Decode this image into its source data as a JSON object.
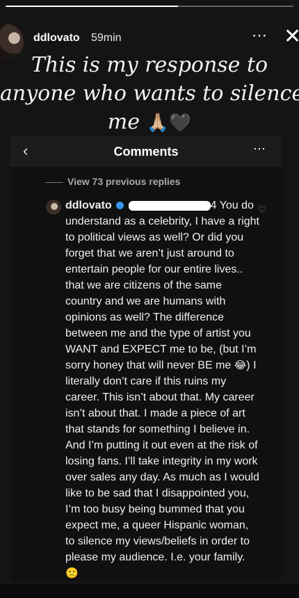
{
  "story": {
    "username": "ddlovato",
    "time_ago": "59min",
    "more_icon": "⋯",
    "close_icon": "✕",
    "caption_line1": "This is my response to",
    "caption_line2": "anyone who wants to silence",
    "caption_line3": "me",
    "caption_emoji": "🙏🏼🖤"
  },
  "comments_panel": {
    "back_icon": "‹",
    "title": "Comments",
    "more_icon": "⋯",
    "view_previous": "View 73 previous replies",
    "comment": {
      "username": "ddlovato",
      "mention_suffix": "4",
      "text_part1": "You do understand as a celebrity, I have a right to political views as well? Or did you forget that we aren’t just around to entertain people for our entire  lives.. that we are citizens of the same country and we are humans with opinions as well? The difference between me and the type of artist you WANT and EXPECT me to be, (but I’m sorry honey that will never BE me ",
      "emoji_1": "😂",
      "text_part2": ") I literally don’t care if this ruins my career. This isn’t about that. My career isn’t about that. I made a piece of art that stands for something I believe in. And I’m putting it out even at the risk of losing fans. I’ll take integrity in my work over sales any day. As much as I would like to be sad that I disappointed you, I’m too busy being bummed that you expect me, a queer Hispanic woman, to silence my views/beliefs in order to please my audience. I.e. your family. ",
      "emoji_2": "🙁",
      "heart_icon": "♡"
    }
  },
  "progress_fraction": 0.6
}
